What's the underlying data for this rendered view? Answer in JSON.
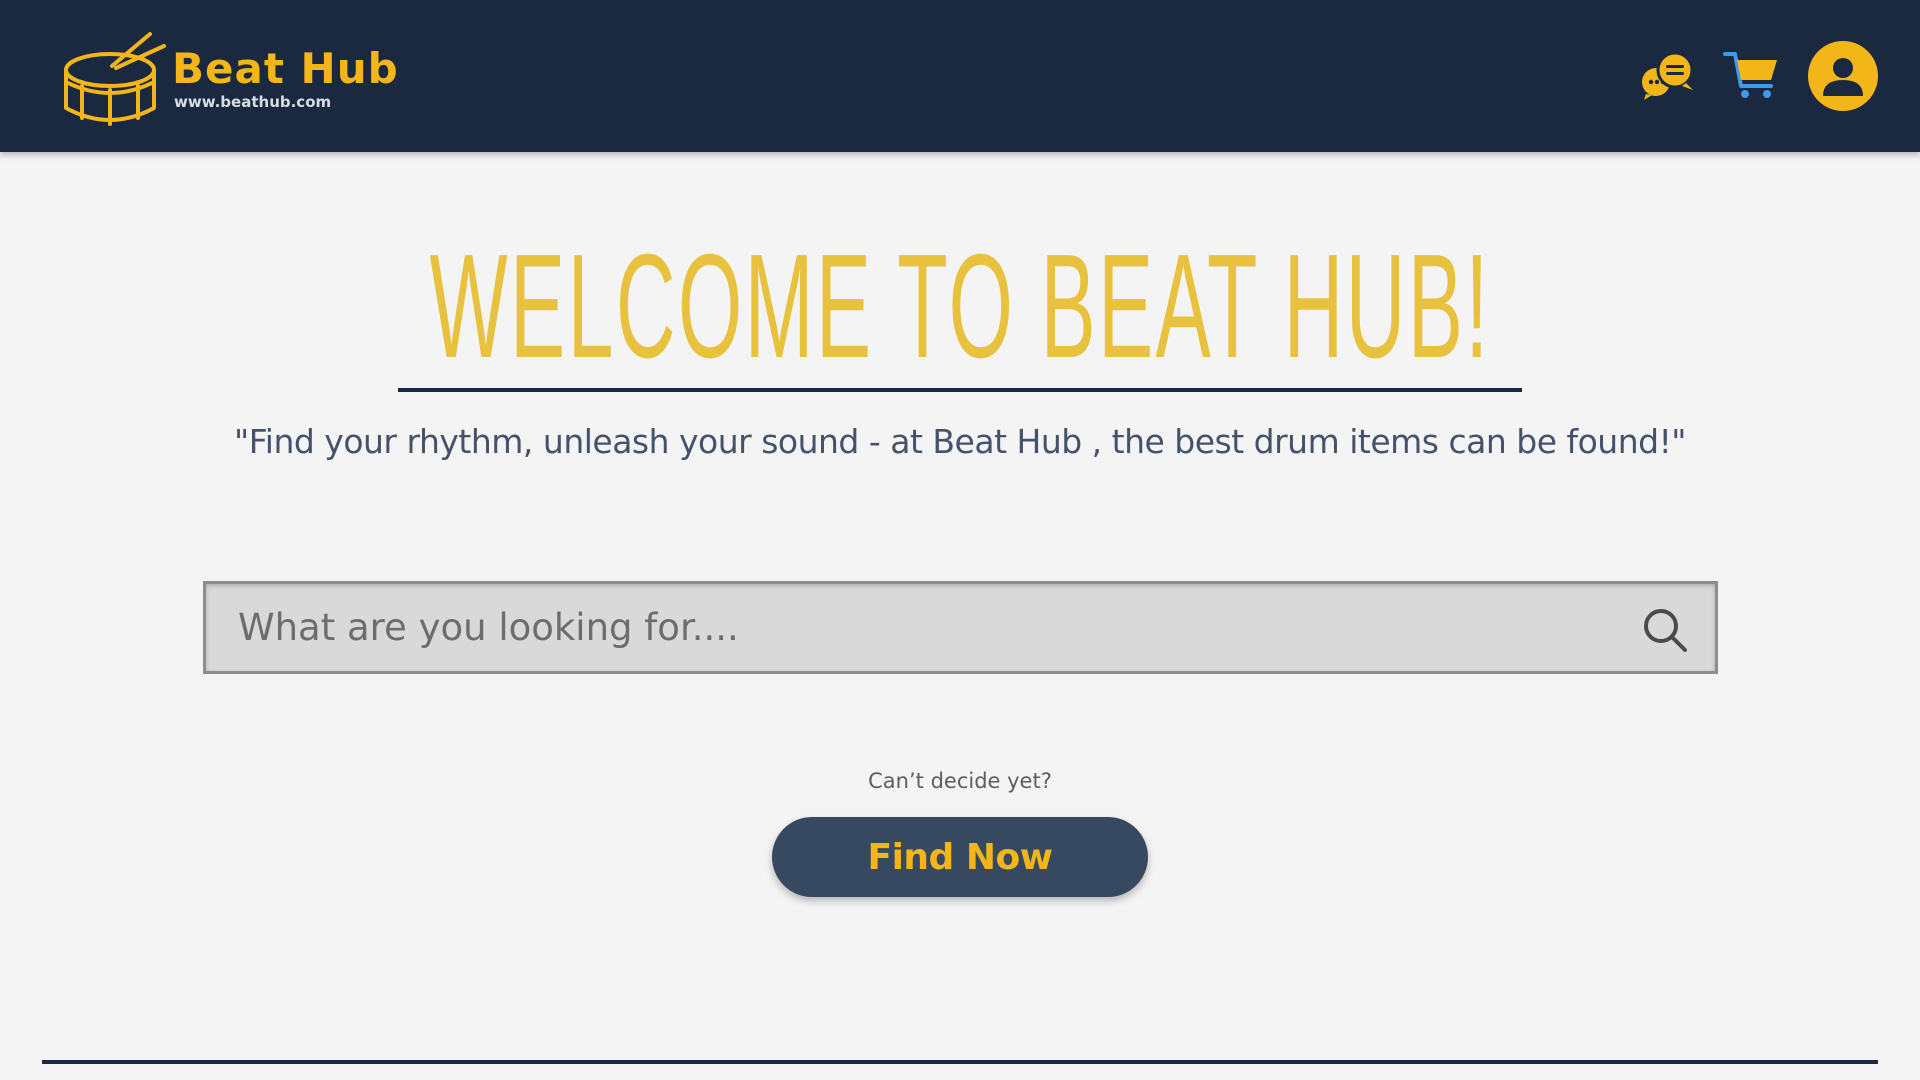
{
  "header": {
    "brand_name": "Beat Hub",
    "brand_url": "www.beathub.com",
    "icons": {
      "logo": "drum-icon",
      "chat": "chat-bubbles-icon",
      "cart": "shopping-cart-icon",
      "account": "user-account-icon"
    }
  },
  "hero": {
    "title": "WELCOME TO BEAT HUB!",
    "tagline": "\"Find your rhythm, unleash your sound - at Beat Hub , the best drum items can be found!\""
  },
  "search": {
    "value": "",
    "placeholder": "What are you looking for....",
    "icon": "search-icon"
  },
  "cta": {
    "note": "Can’t decide yet?",
    "button_label": "Find Now"
  },
  "colors": {
    "header_bg": "#1a2940",
    "accent": "#f2b619",
    "title": "#e8c23f",
    "page_bg": "#f4f4f4",
    "button_bg": "#364961",
    "tagline": "#44536b"
  }
}
